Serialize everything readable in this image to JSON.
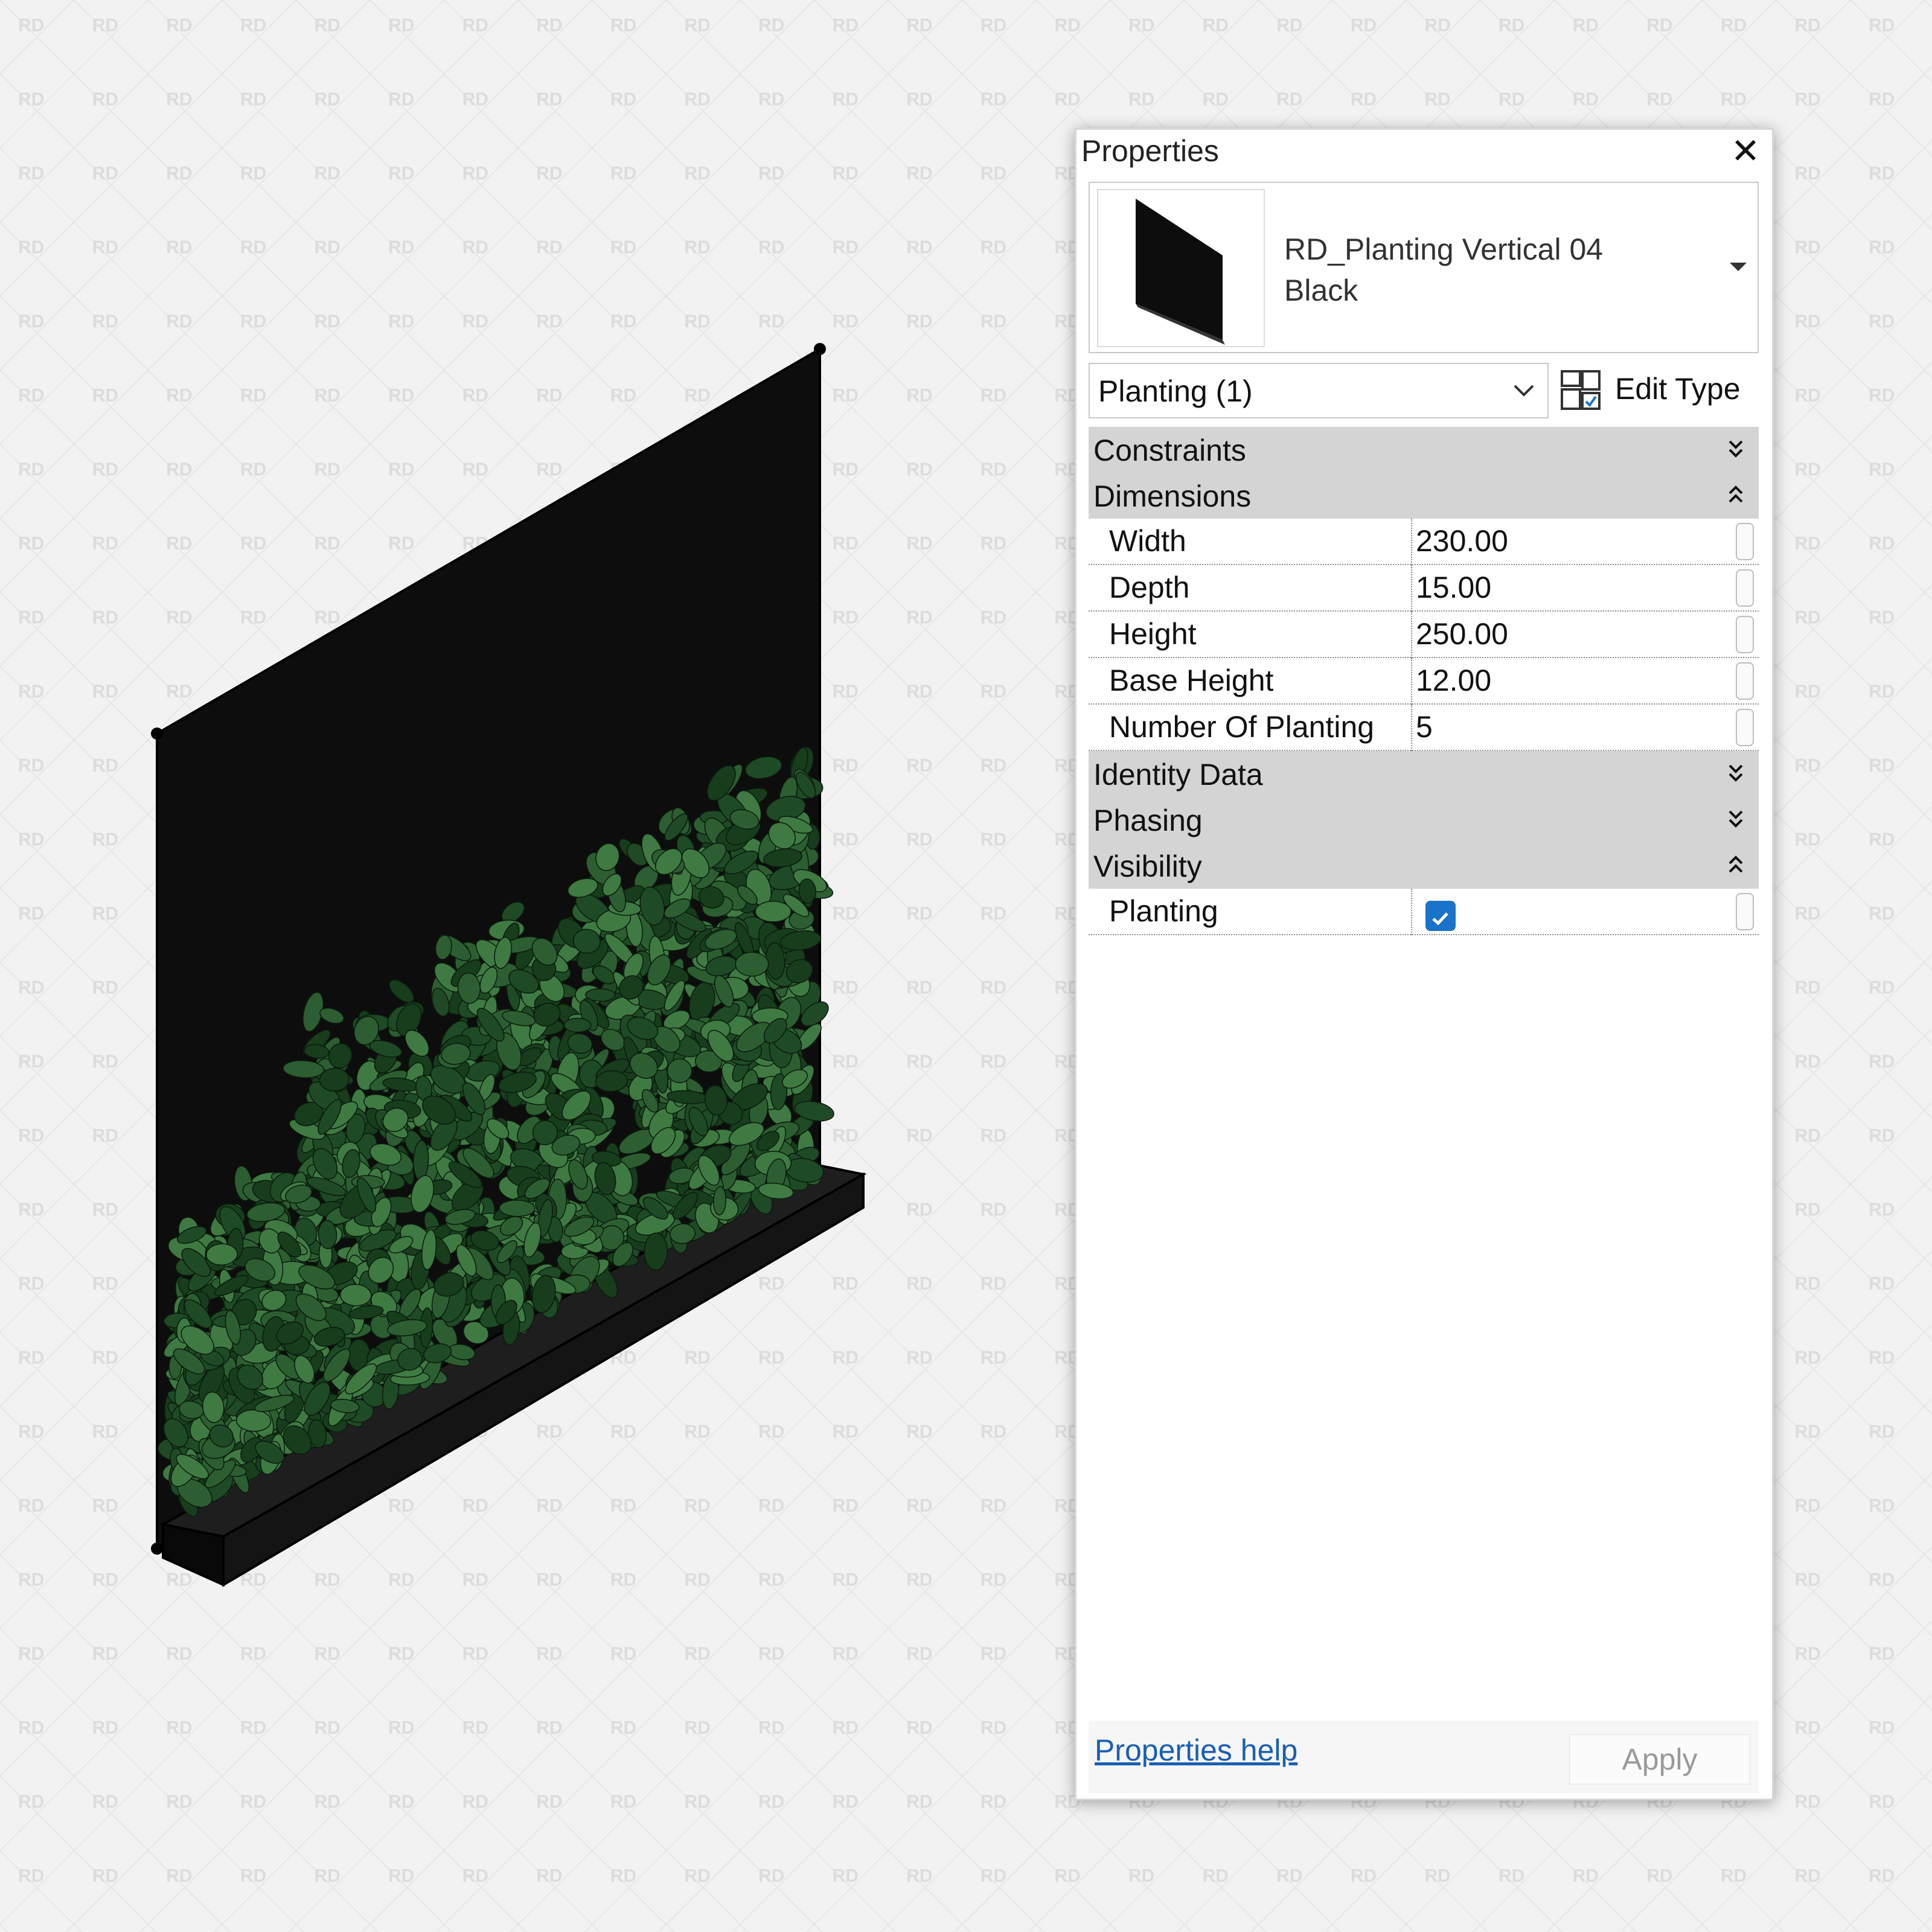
{
  "watermark": {
    "text": "RD"
  },
  "panel": {
    "title": "Properties",
    "close_icon": "close-icon"
  },
  "type_selector": {
    "family_name": "RD_Planting Vertical 04",
    "type_name": "Black"
  },
  "instance_filter": {
    "label": "Planting (1)"
  },
  "edit_type": {
    "label": "Edit Type",
    "icon": "edit-type-icon"
  },
  "groups": {
    "constraints": {
      "label": "Constraints",
      "state": "collapsed"
    },
    "dimensions": {
      "label": "Dimensions",
      "state": "expanded"
    },
    "identity_data": {
      "label": "Identity Data",
      "state": "collapsed"
    },
    "phasing": {
      "label": "Phasing",
      "state": "collapsed"
    },
    "visibility": {
      "label": "Visibility",
      "state": "expanded"
    }
  },
  "dimensions": {
    "width": {
      "name": "Width",
      "value": "230.00"
    },
    "depth": {
      "name": "Depth",
      "value": "15.00"
    },
    "height": {
      "name": "Height",
      "value": "250.00"
    },
    "base_height": {
      "name": "Base Height",
      "value": "12.00"
    },
    "number_of_planting": {
      "name": "Number Of Planting",
      "value": "5"
    }
  },
  "visibility": {
    "planting": {
      "name": "Planting",
      "checked": true
    }
  },
  "footer": {
    "help_label": "Properties help",
    "apply_label": "Apply"
  },
  "colors": {
    "background": "#f2f2f2",
    "panel_black": "#0d0d0d",
    "leaf_dark": "#1f4a26",
    "leaf_light": "#3f7a43",
    "group_header": "#d4d4d4",
    "checkbox": "#1a73c8",
    "link": "#1a5fb4"
  }
}
